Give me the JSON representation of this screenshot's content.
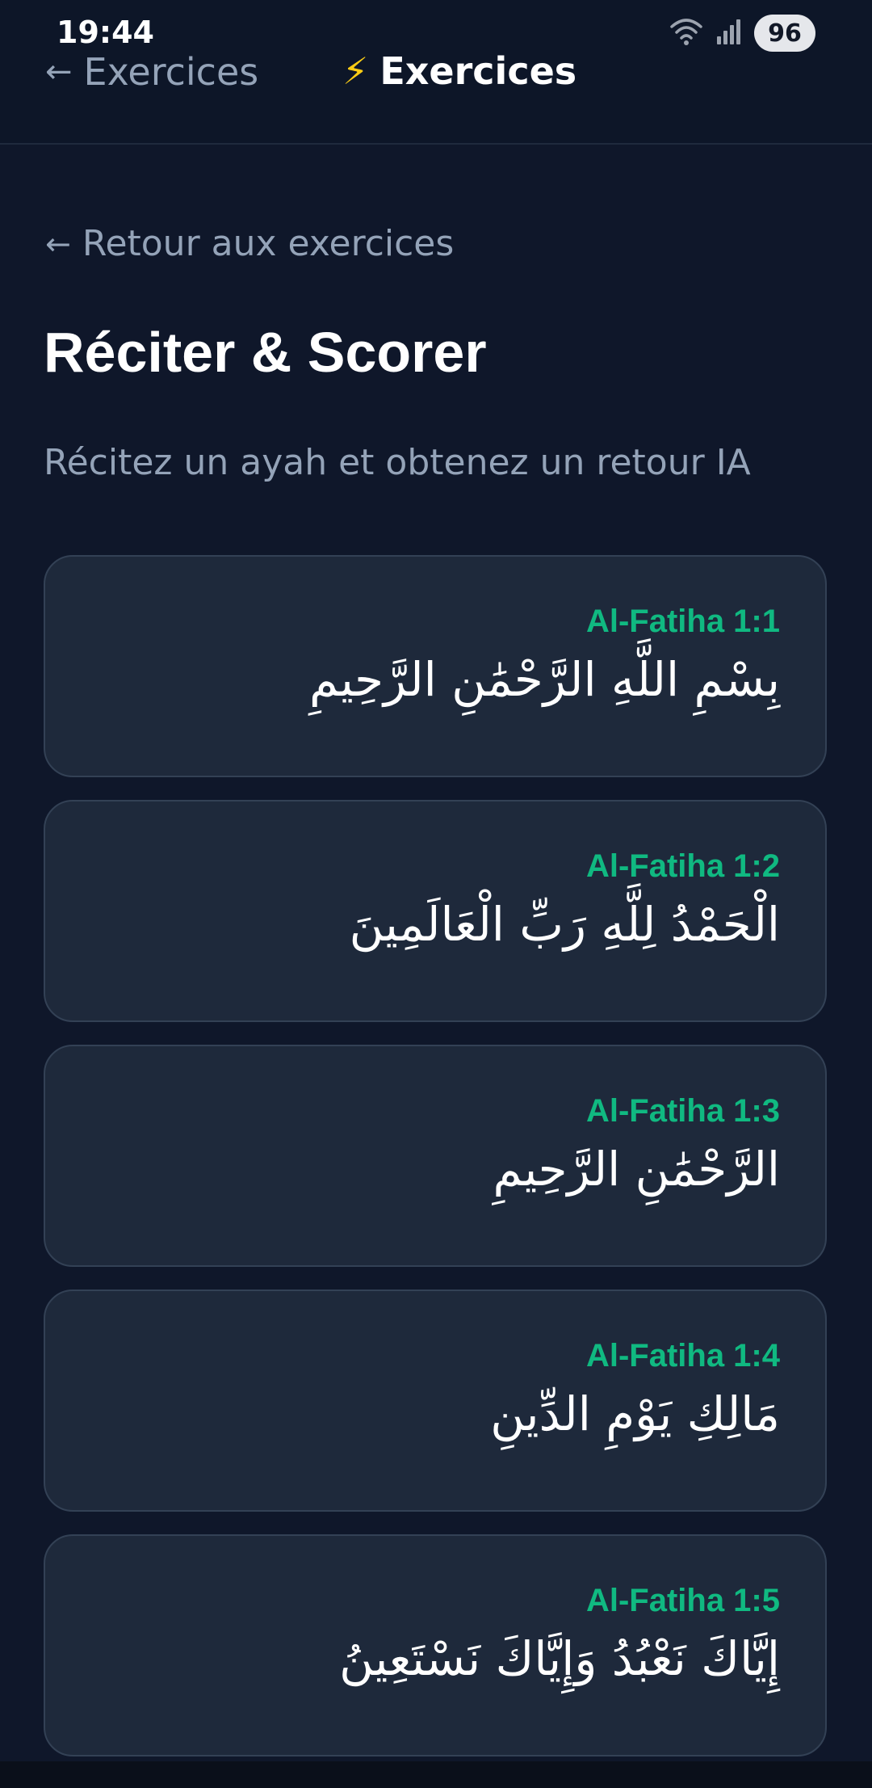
{
  "status_bar": {
    "time": "19:44",
    "battery": "96",
    "icons": [
      "wifi-icon",
      "signal-icon"
    ]
  },
  "nav": {
    "back_arrow": "←",
    "back_label": "Exercices",
    "title_emoji": "⚡",
    "title": "Exercices"
  },
  "page": {
    "back_link_arrow": "←",
    "back_link": "Retour aux exercices",
    "title": "Réciter & Scorer",
    "subtitle": "Récitez un ayah et obtenez un retour IA"
  },
  "ayahs": [
    {
      "ref": "Al-Fatiha 1:1",
      "text": "بِسْمِ اللَّهِ الرَّحْمَٰنِ الرَّحِيمِ"
    },
    {
      "ref": "Al-Fatiha 1:2",
      "text": "الْحَمْدُ لِلَّهِ رَبِّ الْعَالَمِينَ"
    },
    {
      "ref": "Al-Fatiha 1:3",
      "text": "الرَّحْمَٰنِ الرَّحِيمِ"
    },
    {
      "ref": "Al-Fatiha 1:4",
      "text": "مَالِكِ يَوْمِ الدِّينِ"
    },
    {
      "ref": "Al-Fatiha 1:5",
      "text": "إِيَّاكَ نَعْبُدُ وَإِيَّاكَ نَسْتَعِينُ"
    }
  ],
  "colors": {
    "background": "#0f172a",
    "card": "#1e293b",
    "card_border": "#334155",
    "accent": "#10b981",
    "muted_text": "#94a3b8"
  }
}
